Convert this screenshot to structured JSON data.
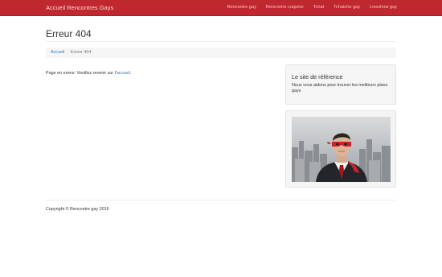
{
  "navbar": {
    "brand": "Accueil Rencontres Gays",
    "items": [
      "Rencontre gay",
      "Rencontre coquine",
      "Tchat",
      "Tchatche gay",
      "Liveshow gay"
    ]
  },
  "main": {
    "title": "Erreur 404",
    "breadcrumb": {
      "home": "Accueil",
      "separator": "/",
      "current": "Erreur 404"
    },
    "message_prefix": "Page en erreur. Veuillez revenir sur l'",
    "message_link": "accueil",
    "message_suffix": "."
  },
  "sidebar": {
    "heading": "Le site de référence",
    "text": "Nous vous aidons pour trouver les meilleurs plans gays"
  },
  "footer": {
    "copyright": "Copyright © Rencontre gay 2016"
  },
  "colors": {
    "navbar": "#c0282f",
    "link": "#337ab7",
    "well": "#f5f5f5"
  }
}
